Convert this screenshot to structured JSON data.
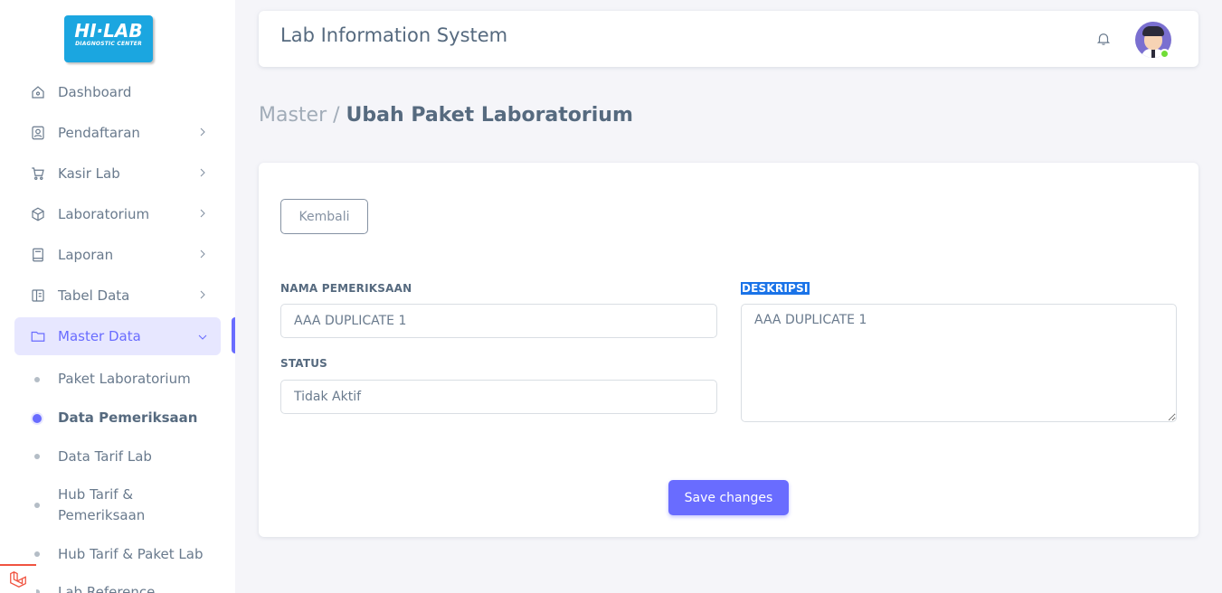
{
  "logo": {
    "main": "HI·LAB",
    "sub": "DIAGNOSTIC CENTER"
  },
  "sidebar": {
    "items": [
      {
        "label": "Dashboard",
        "icon": "home-icon"
      },
      {
        "label": "Pendaftaran",
        "icon": "user-badge-icon"
      },
      {
        "label": "Kasir Lab",
        "icon": "cart-icon"
      },
      {
        "label": "Laboratorium",
        "icon": "box-icon"
      },
      {
        "label": "Laporan",
        "icon": "book-icon"
      },
      {
        "label": "Tabel Data",
        "icon": "table-icon"
      },
      {
        "label": "Master Data",
        "icon": "folder-icon"
      }
    ],
    "submenu": [
      {
        "label": "Paket Laboratorium"
      },
      {
        "label": "Data Pemeriksaan"
      },
      {
        "label": "Data Tarif Lab"
      },
      {
        "label": "Hub Tarif & Pemeriksaan"
      },
      {
        "label": "Hub Tarif & Paket Lab"
      },
      {
        "label": "Lab Reference"
      }
    ]
  },
  "navbar": {
    "title": "Lab Information System"
  },
  "breadcrumb": {
    "parent": "Master /",
    "current": "Ubah Paket Laboratorium"
  },
  "form": {
    "back_label": "Kembali",
    "nama_label": "NAMA PEMERIKSAAN",
    "nama_value": "AAA DUPLICATE 1",
    "status_label": "STATUS",
    "status_value": "Tidak Aktif",
    "deskripsi_label": "DESKRIPSI",
    "deskripsi_value": "AAA DUPLICATE 1",
    "save_label": "Save changes"
  },
  "colors": {
    "primary": "#696cff",
    "text": "#566a7f",
    "background": "#f5f5f9"
  }
}
